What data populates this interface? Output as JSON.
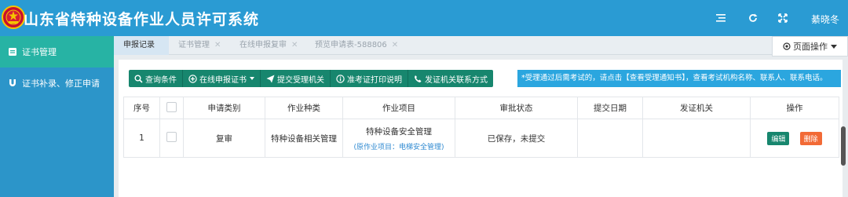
{
  "header": {
    "title": "山东省特种设备作业人员许可系统",
    "user_name": "綦晓冬",
    "icons": [
      "menu-list-icon",
      "refresh-icon",
      "fullscreen-icon"
    ]
  },
  "sidebar": {
    "items": [
      {
        "label": "证书管理",
        "icon": "certificate-icon",
        "active": true
      },
      {
        "label": "证书补录、修正申请",
        "icon": "magnet-icon",
        "active": false
      }
    ]
  },
  "tabs": [
    {
      "label": "申报记录",
      "active": true,
      "closable": false
    },
    {
      "label": "证书管理",
      "active": false,
      "closable": true
    },
    {
      "label": "在线申报复审",
      "active": false,
      "closable": true
    },
    {
      "label": "预览申请表-588806",
      "active": false,
      "closable": true
    }
  ],
  "page_ops_label": "页面操作",
  "toolbar": {
    "query": "查询条件",
    "apply": "在线申报证书",
    "submit_org": "提交受理机关",
    "print_notes": "准考证打印说明",
    "contact": "发证机关联系方式"
  },
  "notice": "*受理通过后需考试的，请点击【查看受理通知书】，查看考试机构名称、联系人、联系电话。",
  "table": {
    "headers": {
      "index": "序号",
      "type": "申请类别",
      "category": "作业种类",
      "item": "作业项目",
      "status": "审批状态",
      "date": "提交日期",
      "org": "发证机关",
      "action": "操作"
    },
    "rows": [
      {
        "index": "1",
        "type": "复审",
        "category": "特种设备相关管理",
        "item": "特种设备安全管理",
        "item_note": "(原作业项目：电梯安全管理)",
        "status": "已保存，未提交",
        "date": "",
        "org": "",
        "edit": "编辑",
        "delete": "删除"
      }
    ]
  },
  "colors": {
    "header_bg": "#2a9bd3",
    "sidebar_bg": "#2c95c9",
    "sidebar_active": "#27b3a4",
    "button_green": "#17866e",
    "notice_bg": "#2ba6df",
    "delete_orange": "#f26a36"
  }
}
